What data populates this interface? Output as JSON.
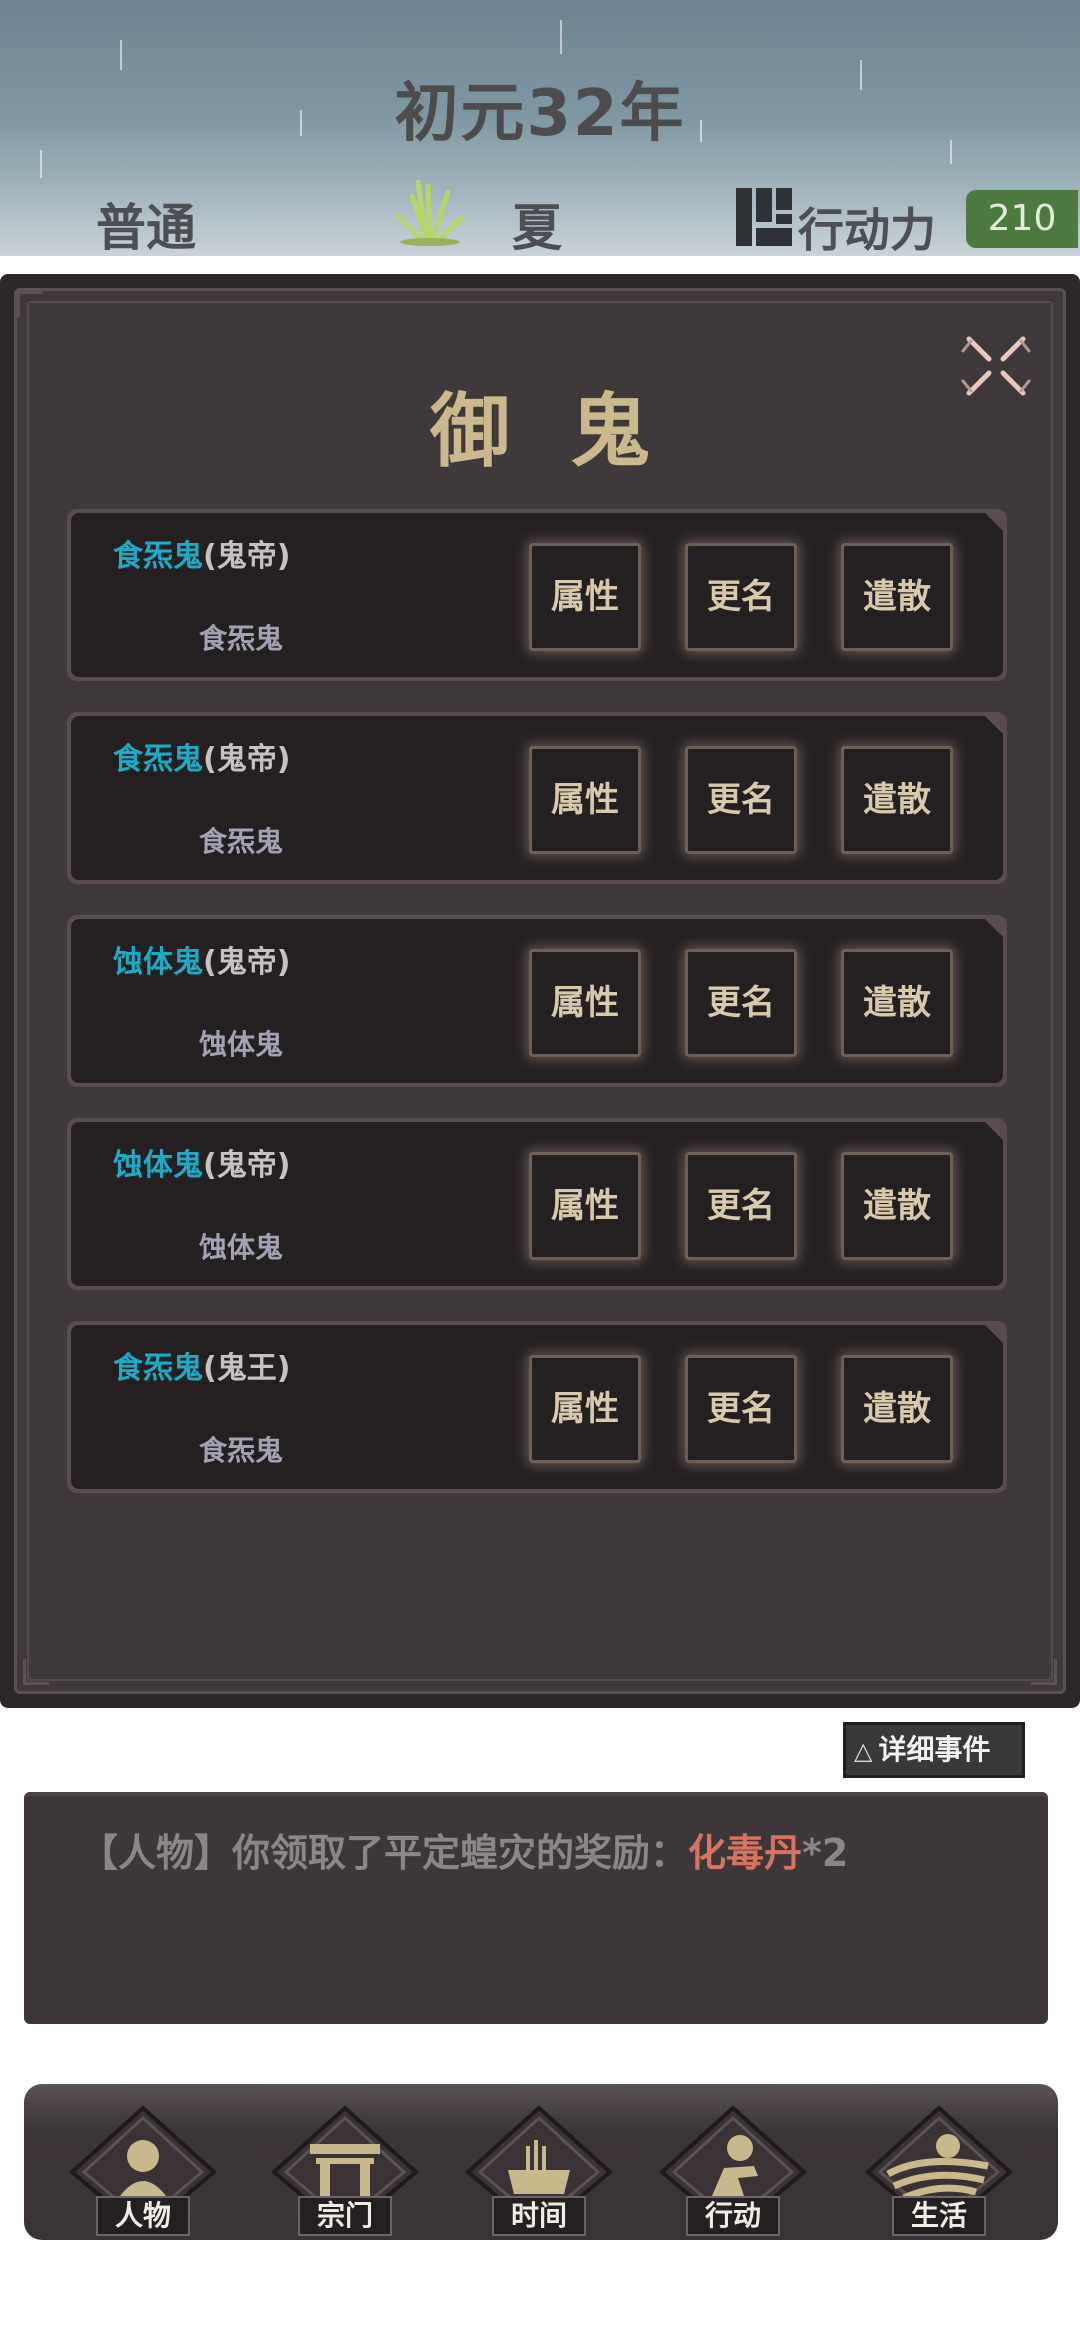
{
  "header": {
    "year": "初元32年",
    "difficulty": "普通",
    "season": "夏",
    "season_icon": "grass-icon",
    "action_points_label": "行动力",
    "action_points_icon": "blocks-icon",
    "action_points_value": "210"
  },
  "dialog": {
    "title": "御鬼",
    "close_icon": "close-x-icon",
    "buttons": {
      "attributes": "属性",
      "rename": "更名",
      "dismiss": "遣散"
    },
    "ghosts": [
      {
        "name": "食炁鬼",
        "rank": "(鬼帝)",
        "type": "食炁鬼"
      },
      {
        "name": "食炁鬼",
        "rank": "(鬼帝)",
        "type": "食炁鬼"
      },
      {
        "name": "蚀体鬼",
        "rank": "(鬼帝)",
        "type": "蚀体鬼"
      },
      {
        "name": "蚀体鬼",
        "rank": "(鬼帝)",
        "type": "蚀体鬼"
      },
      {
        "name": "食炁鬼",
        "rank": "(鬼王)",
        "type": "食炁鬼"
      }
    ]
  },
  "events": {
    "detail_button": "详细事件",
    "detail_icon": "triangle-up-icon",
    "log_prefix": "【人物】你领取了平定蝗灾的奖励：",
    "log_item": "化毒丹",
    "log_suffix": "*2",
    "highlight_color": "#d8735f"
  },
  "nav": {
    "items": [
      {
        "label": "人物",
        "icon": "person-icon"
      },
      {
        "label": "宗门",
        "icon": "sect-gate-icon"
      },
      {
        "label": "时间",
        "icon": "incense-burner-icon"
      },
      {
        "label": "行动",
        "icon": "running-person-icon"
      },
      {
        "label": "生活",
        "icon": "landscape-icon"
      }
    ]
  },
  "colors": {
    "ghost_name": "#1ea9c4",
    "title": "#cbb98d",
    "action_points_bg": "#4d7a3f"
  }
}
